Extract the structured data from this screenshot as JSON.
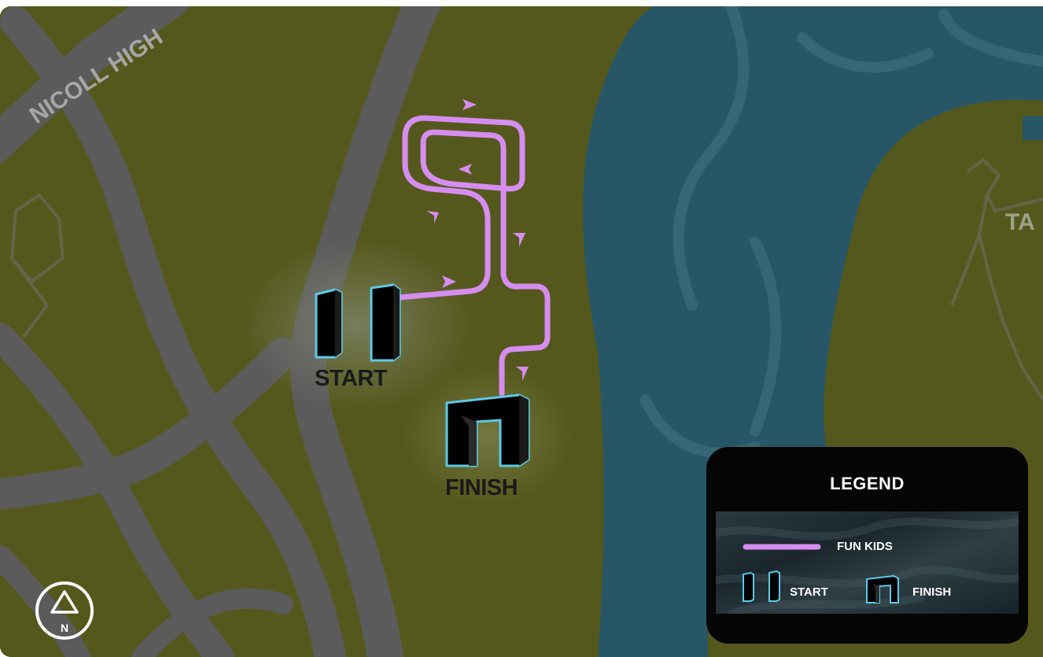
{
  "map": {
    "labels": {
      "road_name": "NICOLL HIGH",
      "edge_label": "TA",
      "start": "START",
      "finish": "FINISH",
      "compass": "N"
    },
    "route": {
      "name": "FUN KIDS",
      "color": "#d68df0"
    },
    "colors": {
      "park": "#55581c",
      "water": "#275666",
      "road": "#5b5b5b",
      "gate_outline": "#5cc9e6"
    }
  },
  "legend": {
    "title": "LEGEND",
    "items": [
      {
        "label": "FUN KIDS",
        "icon": "route-line-icon"
      },
      {
        "label": "START",
        "icon": "start-gate-icon"
      },
      {
        "label": "FINISH",
        "icon": "finish-arch-icon"
      }
    ]
  },
  "compass": {
    "icon": "north-arrow-icon",
    "label": "N"
  }
}
